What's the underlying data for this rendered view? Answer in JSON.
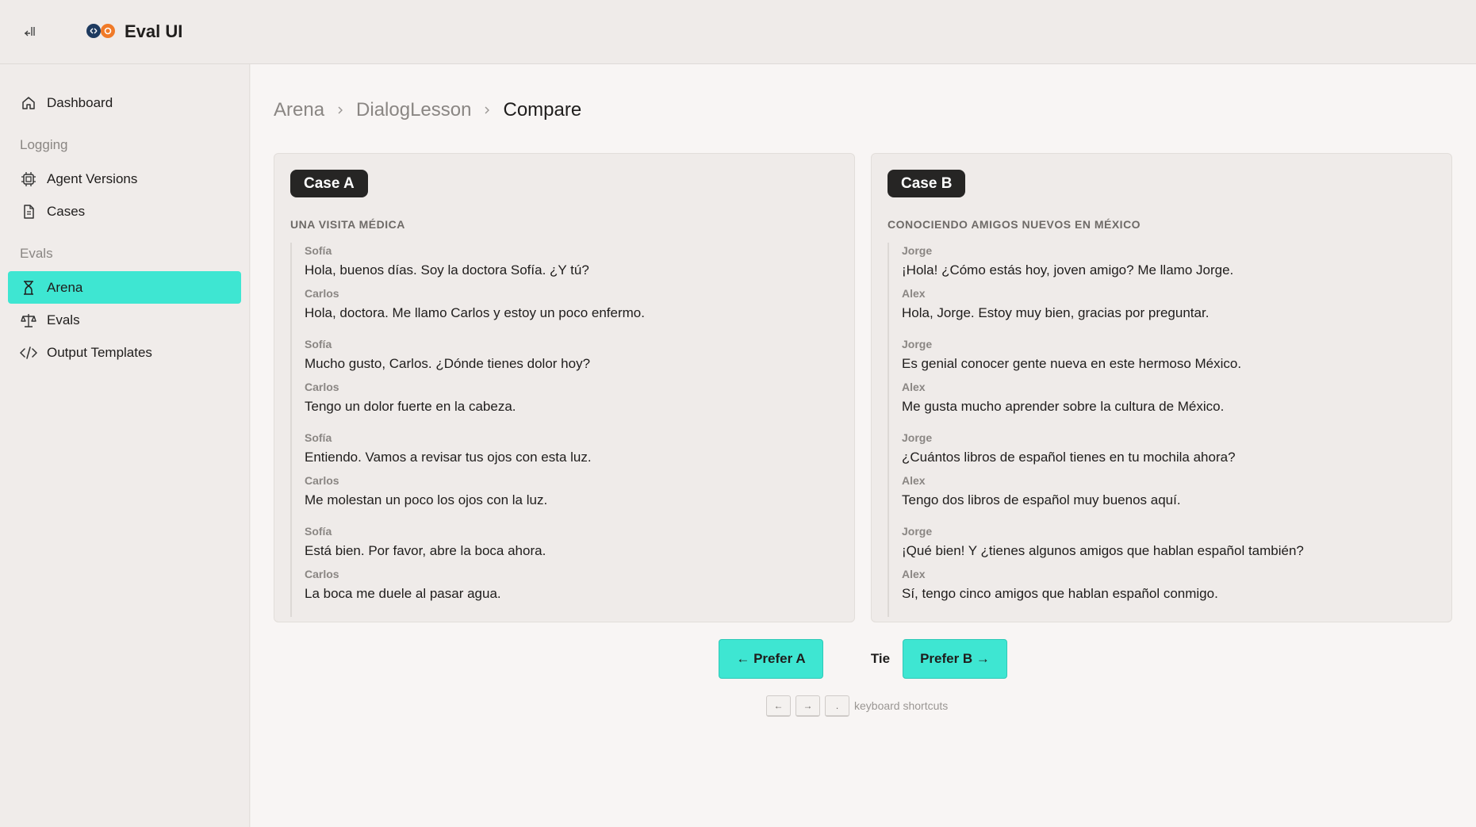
{
  "app": {
    "title": "Eval UI"
  },
  "sidebar": {
    "items": [
      {
        "label": "Dashboard",
        "icon": "home-icon"
      },
      {
        "label": "Agent Versions",
        "icon": "chip-icon"
      },
      {
        "label": "Cases",
        "icon": "document-icon"
      },
      {
        "label": "Arena",
        "icon": "hourglass-icon",
        "active": true
      },
      {
        "label": "Evals",
        "icon": "scale-icon"
      },
      {
        "label": "Output Templates",
        "icon": "code-icon"
      }
    ],
    "sections": {
      "logging": "Logging",
      "evals": "Evals"
    }
  },
  "breadcrumb": [
    "Arena",
    "DialogLesson",
    "Compare"
  ],
  "case_a": {
    "badge": "Case A",
    "title": "UNA VISITA MÉDICA",
    "turns": [
      {
        "s1": "Sofía",
        "m1": "Hola, buenos días. Soy la doctora Sofía. ¿Y tú?",
        "s2": "Carlos",
        "m2": "Hola, doctora. Me llamo Carlos y estoy un poco enfermo."
      },
      {
        "s1": "Sofía",
        "m1": "Mucho gusto, Carlos. ¿Dónde tienes dolor hoy?",
        "s2": "Carlos",
        "m2": "Tengo un dolor fuerte en la cabeza."
      },
      {
        "s1": "Sofía",
        "m1": "Entiendo. Vamos a revisar tus ojos con esta luz.",
        "s2": "Carlos",
        "m2": "Me molestan un poco los ojos con la luz."
      },
      {
        "s1": "Sofía",
        "m1": "Está bien. Por favor, abre la boca ahora.",
        "s2": "Carlos",
        "m2": "La boca me duele al pasar agua."
      }
    ]
  },
  "case_b": {
    "badge": "Case B",
    "title": "CONOCIENDO AMIGOS NUEVOS EN MÉXICO",
    "turns": [
      {
        "s1": "Jorge",
        "m1": "¡Hola! ¿Cómo estás hoy, joven amigo? Me llamo Jorge.",
        "s2": "Alex",
        "m2": "Hola, Jorge. Estoy muy bien, gracias por preguntar."
      },
      {
        "s1": "Jorge",
        "m1": "Es genial conocer gente nueva en este hermoso México.",
        "s2": "Alex",
        "m2": "Me gusta mucho aprender sobre la cultura de México."
      },
      {
        "s1": "Jorge",
        "m1": "¿Cuántos libros de español tienes en tu mochila ahora?",
        "s2": "Alex",
        "m2": "Tengo dos libros de español muy buenos aquí."
      },
      {
        "s1": "Jorge",
        "m1": "¡Qué bien! Y ¿tienes algunos amigos que hablan español también?",
        "s2": "Alex",
        "m2": "Sí, tengo cinco amigos que hablan español conmigo."
      }
    ]
  },
  "actions": {
    "prefer_a": "← Prefer A",
    "tie": "Tie",
    "prefer_b": "Prefer B →"
  },
  "shortcuts": {
    "keys": [
      "←",
      "→",
      "."
    ],
    "label": "keyboard shortcuts"
  },
  "colors": {
    "accent": "#3ee6d2",
    "badge": "#262524"
  }
}
